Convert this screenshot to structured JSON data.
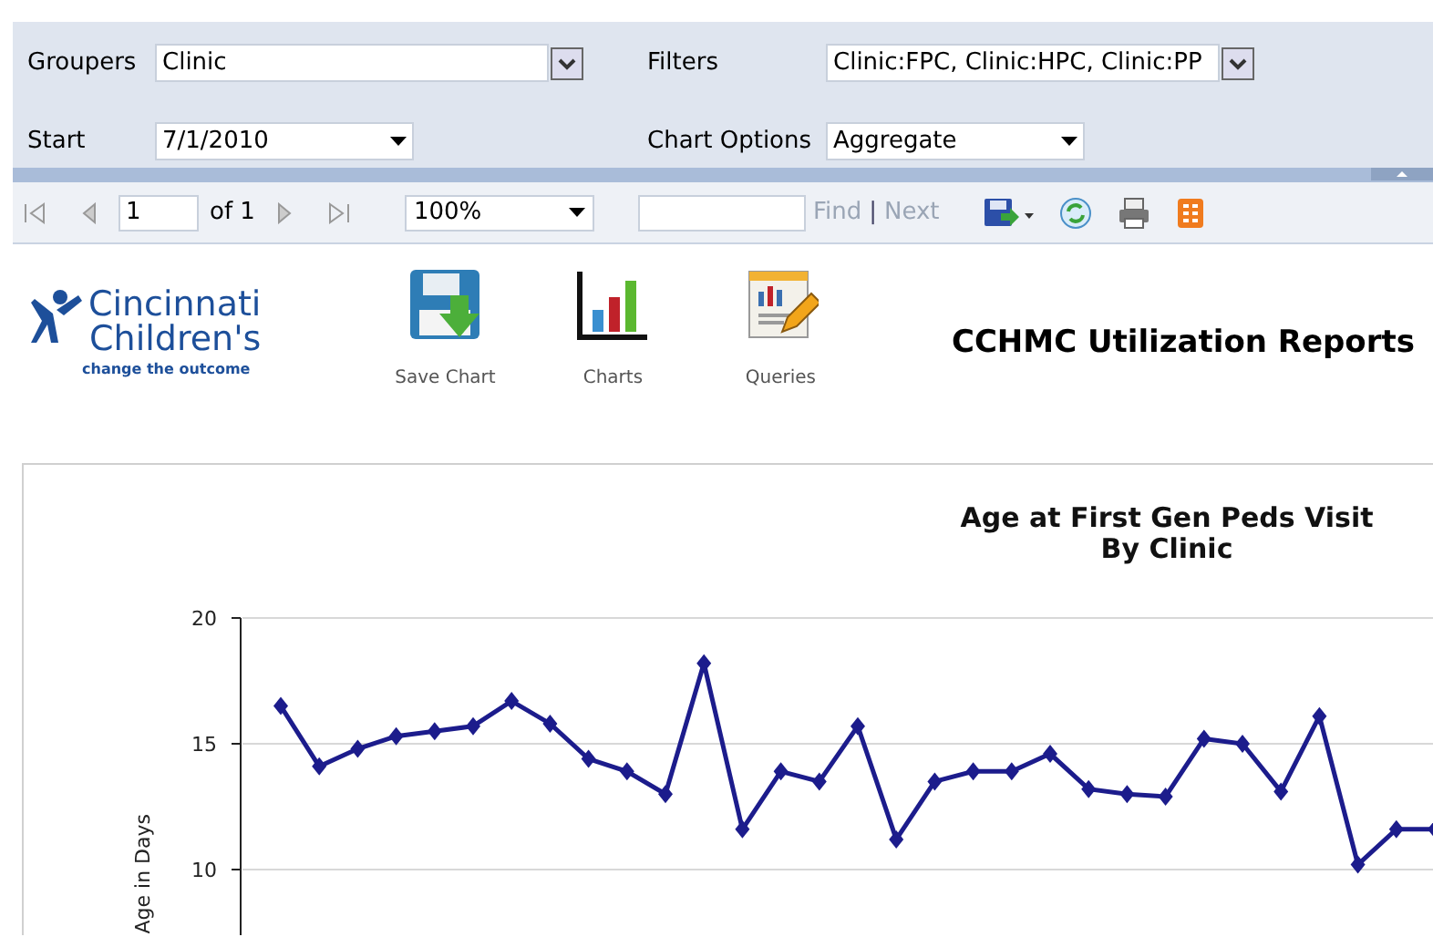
{
  "parameters": [
    {
      "label": "Groupers",
      "value": "Clinic",
      "kind": "multiselect"
    },
    {
      "label": "Filters",
      "value": "Clinic:FPC, Clinic:HPC, Clinic:PP",
      "kind": "multiselect"
    },
    {
      "label": "Start",
      "value": "7/1/2010",
      "kind": "dropdown"
    },
    {
      "label": "Chart Options",
      "value": "Aggregate",
      "kind": "dropdown"
    }
  ],
  "toolbar": {
    "page": "1",
    "of": "of 1",
    "zoom": "100%",
    "find": "Find",
    "separator": "|",
    "next": "Next"
  },
  "header": {
    "logo": {
      "line1": "Cincinnati",
      "line2": "Children's",
      "tagline": "change the outcome"
    },
    "actions": [
      {
        "label": "Save Chart",
        "kind": "save"
      },
      {
        "label": "Charts",
        "kind": "chart"
      },
      {
        "label": "Queries",
        "kind": "query"
      }
    ],
    "title": "CCHMC Utilization Reports"
  },
  "chart_data": {
    "type": "line",
    "title": "Age at First Gen Peds Visit\nBy Clinic",
    "ylabel": "Age in Days",
    "yticks": [
      10,
      15,
      20
    ],
    "ylim": [
      7.3,
      20
    ],
    "series": [
      {
        "color": "#1c1c8c",
        "marker": "diamond",
        "values": [
          16.5,
          14.1,
          14.8,
          15.3,
          15.5,
          15.7,
          16.7,
          15.8,
          14.4,
          13.9,
          13.0,
          18.2,
          11.6,
          13.9,
          13.5,
          15.7,
          11.2,
          13.5,
          13.9,
          13.9,
          14.6,
          13.2,
          13.0,
          12.9,
          15.2,
          15.0,
          13.1,
          16.1,
          10.2,
          11.6,
          11.6
        ]
      }
    ]
  }
}
